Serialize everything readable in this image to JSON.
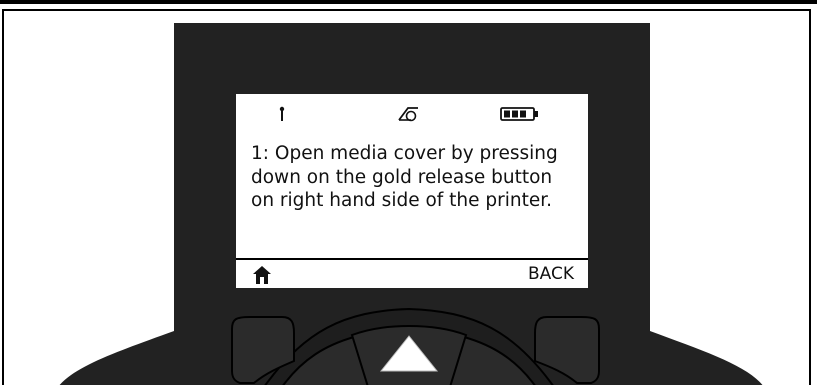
{
  "status_icons": [
    "antenna-icon",
    "wireless-icon",
    "battery-icon"
  ],
  "display": {
    "message": "1: Open media cover by pressing down on the gold release button on right hand side of the printer.",
    "left_softkey_icon": "home-icon",
    "right_softkey_label": "BACK"
  },
  "keypad": [
    "left-softkey-button",
    "up-arrow-button",
    "right-softkey-button"
  ],
  "colors": {
    "device_body": "#222222",
    "screen": "#ffffff",
    "keys": "#2b2b2b",
    "outline": "#000000"
  }
}
